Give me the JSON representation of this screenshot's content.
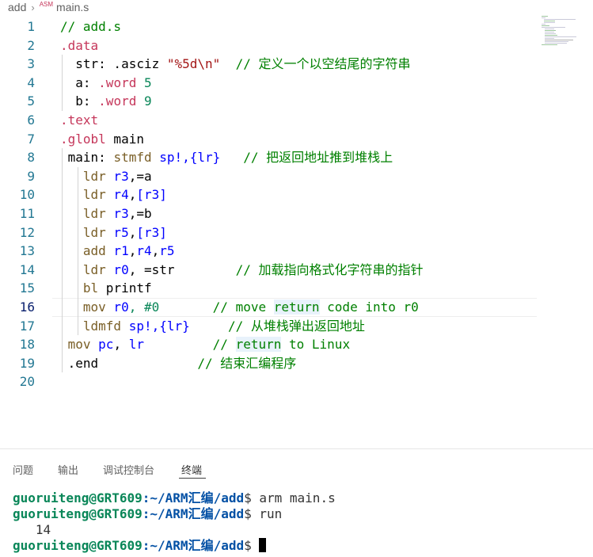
{
  "breadcrumb": {
    "folder": "add",
    "file_icon": "ASM",
    "file": "main.s"
  },
  "editor": {
    "active_line": 16,
    "lines": [
      {
        "num": "1",
        "tokens": [
          {
            "t": "// add.s",
            "c": "t-cmt"
          }
        ]
      },
      {
        "num": "2",
        "tokens": [
          {
            "t": ".data",
            "c": "t-dot"
          }
        ]
      },
      {
        "num": "3",
        "tokens": [
          {
            "t": "  str: .asciz ",
            "c": "t-txt"
          },
          {
            "t": "\"%5d\\n\"",
            "c": "t-str"
          },
          {
            "t": "  ",
            "c": "t-txt"
          },
          {
            "t": "// 定义一个以空结尾的字符串",
            "c": "t-cmt"
          }
        ]
      },
      {
        "num": "4",
        "tokens": [
          {
            "t": "  a: ",
            "c": "t-txt"
          },
          {
            "t": ".word",
            "c": "t-dot"
          },
          {
            "t": " 5",
            "c": "t-num"
          }
        ]
      },
      {
        "num": "5",
        "tokens": [
          {
            "t": "  b: ",
            "c": "t-txt"
          },
          {
            "t": ".word",
            "c": "t-dot"
          },
          {
            "t": " 9",
            "c": "t-num"
          }
        ]
      },
      {
        "num": "6",
        "tokens": [
          {
            "t": ".text",
            "c": "t-dot"
          }
        ]
      },
      {
        "num": "7",
        "tokens": [
          {
            "t": ".globl",
            "c": "t-dot"
          },
          {
            "t": " main",
            "c": "t-txt"
          }
        ]
      },
      {
        "num": "8",
        "tokens": [
          {
            "t": " main: ",
            "c": "t-txt"
          },
          {
            "t": "stmfd",
            "c": "t-dir"
          },
          {
            "t": " sp!,{lr}",
            "c": "t-reg"
          },
          {
            "t": "   ",
            "c": "t-txt"
          },
          {
            "t": "// 把返回地址推到堆栈上",
            "c": "t-cmt"
          }
        ]
      },
      {
        "num": "9",
        "tokens": [
          {
            "t": "   ldr",
            "c": "t-dir"
          },
          {
            "t": " r3",
            "c": "t-reg"
          },
          {
            "t": ",=a",
            "c": "t-txt"
          }
        ]
      },
      {
        "num": "10",
        "tokens": [
          {
            "t": "   ldr",
            "c": "t-dir"
          },
          {
            "t": " r4",
            "c": "t-reg"
          },
          {
            "t": ",",
            "c": "t-txt"
          },
          {
            "t": "[r3]",
            "c": "t-reg"
          }
        ]
      },
      {
        "num": "11",
        "tokens": [
          {
            "t": "   ldr",
            "c": "t-dir"
          },
          {
            "t": " r3",
            "c": "t-reg"
          },
          {
            "t": ",=b",
            "c": "t-txt"
          }
        ]
      },
      {
        "num": "12",
        "tokens": [
          {
            "t": "   ldr",
            "c": "t-dir"
          },
          {
            "t": " r5",
            "c": "t-reg"
          },
          {
            "t": ",",
            "c": "t-txt"
          },
          {
            "t": "[r3]",
            "c": "t-reg"
          }
        ]
      },
      {
        "num": "13",
        "tokens": [
          {
            "t": "   add",
            "c": "t-dir"
          },
          {
            "t": " r1",
            "c": "t-reg"
          },
          {
            "t": ",",
            "c": "t-txt"
          },
          {
            "t": "r4",
            "c": "t-reg"
          },
          {
            "t": ",",
            "c": "t-txt"
          },
          {
            "t": "r5",
            "c": "t-reg"
          }
        ]
      },
      {
        "num": "14",
        "tokens": [
          {
            "t": "   ldr",
            "c": "t-dir"
          },
          {
            "t": " r0",
            "c": "t-reg"
          },
          {
            "t": ", =str",
            "c": "t-txt"
          },
          {
            "t": "        ",
            "c": "t-txt"
          },
          {
            "t": "// 加载指向格式化字符串的指针",
            "c": "t-cmt"
          }
        ]
      },
      {
        "num": "15",
        "tokens": [
          {
            "t": "   bl",
            "c": "t-dir"
          },
          {
            "t": " printf",
            "c": "t-txt"
          }
        ]
      },
      {
        "num": "16",
        "tokens": [
          {
            "t": "   mov",
            "c": "t-dir"
          },
          {
            "t": " r0",
            "c": "t-reg"
          },
          {
            "t": ", #0",
            "c": "t-num"
          },
          {
            "t": "       ",
            "c": "t-txt"
          },
          {
            "t": "// move ",
            "c": "t-cmt"
          },
          {
            "t": "return",
            "c": "t-cmt hl"
          },
          {
            "t": " code into r0",
            "c": "t-cmt"
          }
        ]
      },
      {
        "num": "17",
        "tokens": [
          {
            "t": "   ldmfd",
            "c": "t-dir"
          },
          {
            "t": " sp!,{lr}",
            "c": "t-reg"
          },
          {
            "t": "     ",
            "c": "t-txt"
          },
          {
            "t": "// 从堆栈弹出返回地址",
            "c": "t-cmt"
          }
        ]
      },
      {
        "num": "18",
        "tokens": [
          {
            "t": " mov",
            "c": "t-dir"
          },
          {
            "t": " pc",
            "c": "t-reg"
          },
          {
            "t": ", ",
            "c": "t-txt"
          },
          {
            "t": "lr",
            "c": "t-reg"
          },
          {
            "t": "         ",
            "c": "t-txt"
          },
          {
            "t": "// ",
            "c": "t-cmt"
          },
          {
            "t": "return",
            "c": "t-cmt hl"
          },
          {
            "t": " to Linux",
            "c": "t-cmt"
          }
        ]
      },
      {
        "num": "19",
        "tokens": [
          {
            "t": " .end",
            "c": "t-txt"
          },
          {
            "t": "             ",
            "c": "t-txt"
          },
          {
            "t": "// 结束汇编程序",
            "c": "t-cmt"
          }
        ]
      },
      {
        "num": "20",
        "tokens": []
      }
    ]
  },
  "panel": {
    "tabs": [
      {
        "label": "问题",
        "active": false
      },
      {
        "label": "输出",
        "active": false
      },
      {
        "label": "调试控制台",
        "active": false
      },
      {
        "label": "终端",
        "active": true
      }
    ],
    "terminal": {
      "user": "guoruiteng@GRT609",
      "path": ":~/ARM汇编/add",
      "lines": [
        {
          "kind": "prompt",
          "cmd": "$ arm main.s"
        },
        {
          "kind": "prompt",
          "cmd": "$ run"
        },
        {
          "kind": "output",
          "text": "   14"
        },
        {
          "kind": "prompt",
          "cmd": "$ "
        }
      ]
    }
  },
  "colors": {
    "comment": "#008000",
    "directive": "#c5365a",
    "register": "#0000ff",
    "string": "#a31515",
    "number": "#098658",
    "line_number": "#237893",
    "terminal_user": "#098658",
    "terminal_path": "#0451a5"
  }
}
